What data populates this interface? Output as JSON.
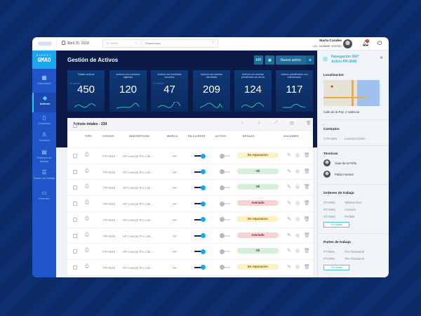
{
  "topbar": {
    "date": "Abril 25, 2018",
    "select_placeholder": "En GMAO",
    "search_placeholder": "Palabra clave",
    "user_name": "Marta Condés",
    "user_center": "124 - NOMBRE CENTRO",
    "notifications": "1"
  },
  "sidebar": {
    "logo_top": "EXPERT",
    "logo_bottom": "GMAO",
    "items": [
      {
        "label": "Dashboard",
        "icon": "grid-icon"
      },
      {
        "label": "Activos",
        "icon": "diamond-icon",
        "active": true
      },
      {
        "label": "Contratos",
        "icon": "document-icon"
      },
      {
        "label": "Técnicos",
        "icon": "user-icon"
      },
      {
        "label": "Ordenes de trabajo",
        "icon": "clipboard-icon"
      },
      {
        "label": "Partes de trabajo",
        "icon": "list-icon"
      },
      {
        "label": "Informes",
        "icon": "presentation-icon"
      }
    ]
  },
  "main": {
    "title": "Gestión de Activos",
    "kpi_label": "KPI",
    "new_label": "Nuevo activo",
    "cards": [
      {
        "title": "Totales activos",
        "period": "12 meses",
        "value": "450"
      },
      {
        "title": "Activos con contratos vigentes",
        "value": "120"
      },
      {
        "title": "Activos con contratos vencidos",
        "period": "12 meses",
        "value": "47"
      },
      {
        "title": "Activos con averias atendidas",
        "value": "209"
      },
      {
        "title": "Activos con averias pendientes de cerrar",
        "value": "124"
      },
      {
        "title": "Activos planificados con intervención",
        "value": "117"
      }
    ],
    "table": {
      "title": "Activos totales - 234",
      "columns": [
        "TIPO",
        "CODIGO",
        "DESCRIPCIÓN",
        "MARCA",
        "EN CLIENTE",
        "ACTIVO",
        "ESTADO",
        "ACCIONES"
      ],
      "rows": [
        {
          "code": "PR-0045",
          "desc": "HP Laserjet Pro Link...",
          "brand": "HP",
          "status": "En reparacion"
        },
        {
          "code": "PR-0045",
          "desc": "HP Laserjet Pro Link...",
          "brand": "HP",
          "status": "Ok"
        },
        {
          "code": "PR-0045",
          "desc": "HP Laserjet Pro Link...",
          "brand": "HP",
          "status": "Ok"
        },
        {
          "code": "PR-0045",
          "desc": "HP Laserjet Pro Link...",
          "brand": "HP",
          "status": "Averiado"
        },
        {
          "code": "PR-0045",
          "desc": "HP Laserjet Pro Link...",
          "brand": "HP",
          "status": "En reparacion"
        },
        {
          "code": "PR-0045",
          "desc": "HP Laserjet Pro Link...",
          "brand": "HP",
          "status": "Averiado"
        },
        {
          "code": "PR-0045",
          "desc": "HP Laserjet Pro Link...",
          "brand": "HP",
          "status": "Ok"
        },
        {
          "code": "PR-0045",
          "desc": "HP Laserjet Pro Link...",
          "brand": "HP",
          "status": "En reparacion"
        },
        {
          "code": "PR-0045",
          "desc": "HP Laserjet Pro Link...",
          "brand": "HP",
          "status": "Averiado"
        }
      ]
    }
  },
  "status_colors": {
    "En reparacion": [
      "#fdf0c4",
      "#7a5a00"
    ],
    "Ok": [
      "#d5efd8",
      "#1d5b2a"
    ],
    "Averiado": [
      "#f7d3d6",
      "#8a1f2b"
    ]
  },
  "panel": {
    "title1": "Navegación 360°",
    "title2": "Activo PR-0045",
    "loc_h": "Localizacion",
    "address": "Calle de la Paz, 2 Valencia",
    "contracts_h": "Contratos",
    "contract_code": "CTR-0001",
    "contract_name": "Leonard Cohen",
    "tech_h": "Tecnicos",
    "techs": [
      "Juan de la Peña",
      "Pablo Fuertes"
    ],
    "orders_h": "Ordenes de trabajo",
    "orders": [
      [
        "OT-0001",
        "Talleres Ruiz"
      ],
      [
        "OT-0004",
        "Consum"
      ],
      [
        "OT-0004",
        "Profitek"
      ]
    ],
    "ver": "Ver todas",
    "parts_h": "Partes de trabajo",
    "parts": [
      [
        "PT-0001",
        "Tim Timebomb"
      ],
      [
        "PT-0001",
        "Tim Timebomb"
      ]
    ]
  }
}
